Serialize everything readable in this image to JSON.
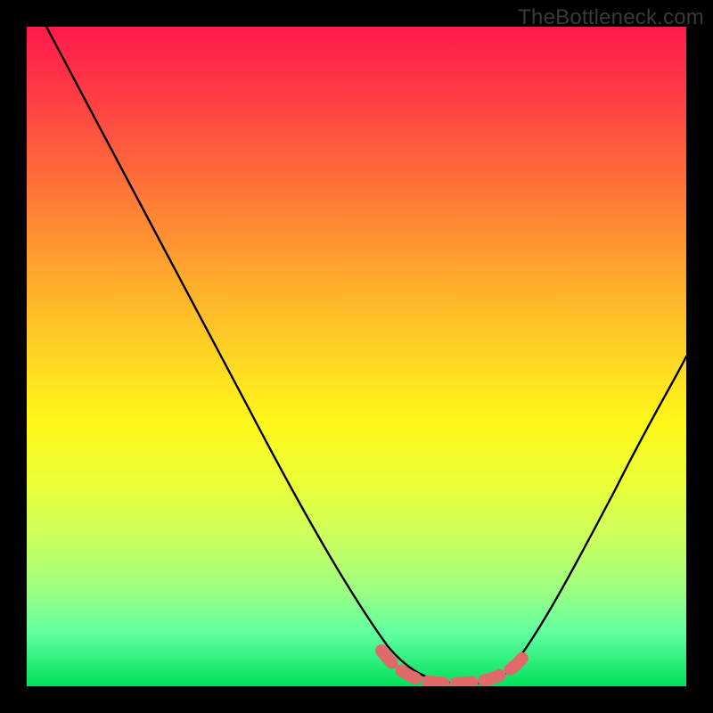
{
  "watermark": "TheBottleneck.com",
  "chart_data": {
    "type": "line",
    "title": "",
    "xlabel": "",
    "ylabel": "",
    "xlim": [
      0,
      100
    ],
    "ylim": [
      0,
      100
    ],
    "grid": false,
    "series": [
      {
        "name": "curve",
        "x": [
          3,
          10,
          20,
          30,
          40,
          48,
          55,
          62,
          68,
          72,
          78,
          85,
          92,
          100
        ],
        "values": [
          100,
          84,
          66,
          49,
          32,
          18,
          8,
          2,
          0,
          0,
          4,
          16,
          32,
          50
        ]
      }
    ],
    "highlight": {
      "name": "bottom-dash-band",
      "x": [
        55,
        60,
        65,
        70,
        75
      ],
      "values": [
        6,
        2,
        0,
        0,
        3
      ]
    },
    "background_gradient": {
      "top": "#ff1a4b",
      "mid": "#fff71a",
      "bottom": "#00e05a"
    }
  }
}
